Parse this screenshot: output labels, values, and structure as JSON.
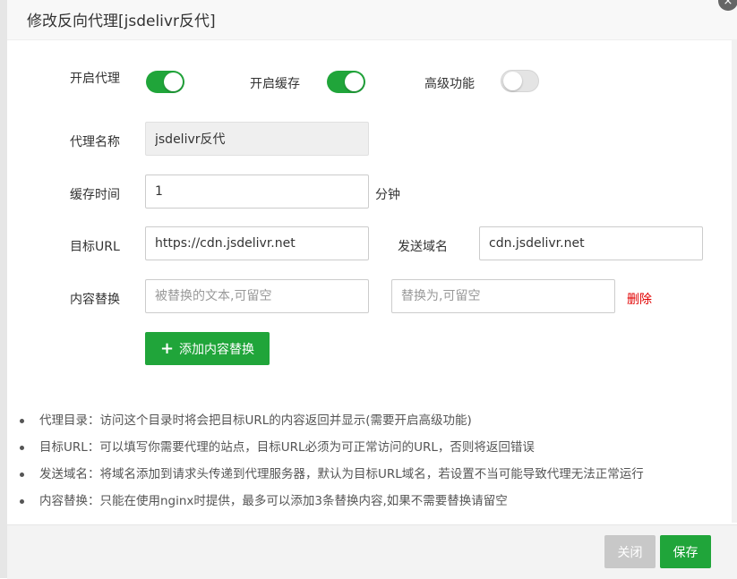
{
  "dialog": {
    "title": "修改反向代理[jsdelivr反代]",
    "close_icon": "×"
  },
  "toggles": {
    "proxy": {
      "label": "开启代理",
      "on": true
    },
    "cache": {
      "label": "开启缓存",
      "on": true
    },
    "advanced": {
      "label": "高级功能",
      "on": false
    }
  },
  "form": {
    "name_label": "代理名称",
    "name_value": "jsdelivr反代",
    "cache_time_label": "缓存时间",
    "cache_time_value": "1",
    "cache_time_unit": "分钟",
    "target_url_label": "目标URL",
    "target_url_value": "https://cdn.jsdelivr.net",
    "send_domain_label": "发送域名",
    "send_domain_value": "cdn.jsdelivr.net",
    "replace_label": "内容替换",
    "replace_from_placeholder": "被替换的文本,可留空",
    "replace_to_placeholder": "替换为,可留空",
    "delete_label": "删除",
    "add_replace_label": "添加内容替换"
  },
  "notes": [
    "代理目录：访问这个目录时将会把目标URL的内容返回并显示(需要开启高级功能)",
    "目标URL：可以填写你需要代理的站点，目标URL必须为可正常访问的URL，否则将返回错误",
    "发送域名：将域名添加到请求头传递到代理服务器，默认为目标URL域名，若设置不当可能导致代理无法正常运行",
    "内容替换：只能在使用nginx时提供，最多可以添加3条替换内容,如果不需要替换请留空"
  ],
  "footer": {
    "close_label": "关闭",
    "save_label": "保存"
  },
  "colors": {
    "accent": "#20a53a",
    "danger": "#e10000",
    "disabled": "#c8c8c8"
  }
}
